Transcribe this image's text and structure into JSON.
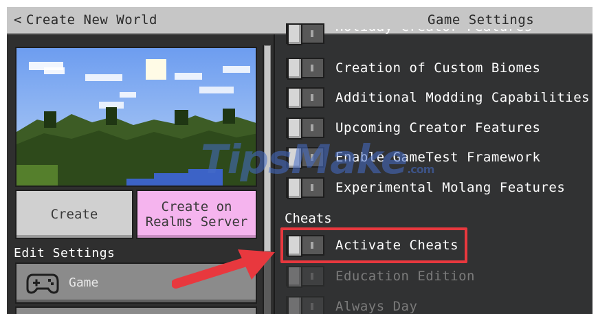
{
  "header": {
    "back_label": "Create New World",
    "title": "Game Settings"
  },
  "left": {
    "create_label": "Create",
    "realms_label": "Create on\nRealms Server",
    "edit_settings_label": "Edit Settings",
    "game_label": "Game"
  },
  "right": {
    "partial_label": "Holiday Creator Features",
    "toggles": [
      {
        "label": "Creation of Custom Biomes",
        "on": false,
        "enabled": true
      },
      {
        "label": "Additional Modding Capabilities",
        "on": false,
        "enabled": true
      },
      {
        "label": "Upcoming Creator Features",
        "on": false,
        "enabled": true
      },
      {
        "label": "Enable GameTest Framework",
        "on": false,
        "enabled": true
      },
      {
        "label": "Experimental Molang Features",
        "on": false,
        "enabled": true
      }
    ],
    "cheats_header": "Cheats",
    "cheats": [
      {
        "label": "Activate Cheats",
        "on": false,
        "enabled": true
      },
      {
        "label": "Education Edition",
        "on": false,
        "enabled": false
      },
      {
        "label": "Always Day",
        "on": false,
        "enabled": false
      }
    ]
  },
  "watermark": {
    "text": "TipsMake",
    "suffix": ".com"
  },
  "colors": {
    "highlight": "#e8383e",
    "realms_button": "#f5b4ee",
    "panel": "#313233"
  }
}
